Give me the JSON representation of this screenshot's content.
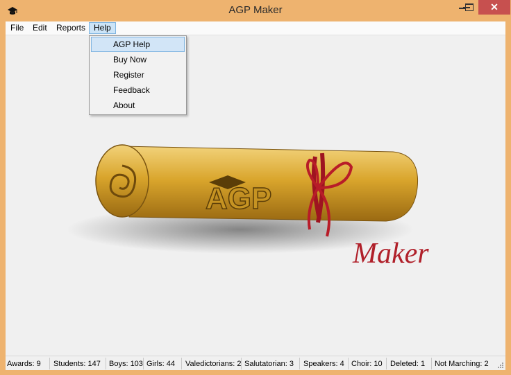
{
  "window": {
    "title": "AGP Maker",
    "accent": "#eeb36f",
    "close_color": "#c7504f",
    "close_glyph": "✕"
  },
  "menu": [
    {
      "label": "File"
    },
    {
      "label": "Edit"
    },
    {
      "label": "Reports"
    },
    {
      "label": "Help",
      "active": true
    }
  ],
  "help_menu": {
    "items": [
      {
        "label": "AGP Help",
        "highlighted": true
      },
      {
        "label": "Buy Now"
      },
      {
        "label": "Register"
      },
      {
        "label": "Feedback"
      },
      {
        "label": "About"
      }
    ]
  },
  "logo": {
    "brand_text": "AGP",
    "maker_text": "Maker",
    "maker_color": "#b0202a"
  },
  "status": [
    {
      "label": "Awards: 9"
    },
    {
      "label": "Students: 147"
    },
    {
      "label": "Boys: 103"
    },
    {
      "label": "Girls: 44"
    },
    {
      "label": "Valedictorians: 2"
    },
    {
      "label": "Salutatorian: 3"
    },
    {
      "label": "Speakers: 4"
    },
    {
      "label": "Choir: 10"
    },
    {
      "label": "Deleted: 1"
    },
    {
      "label": "Not Marching: 2"
    }
  ]
}
